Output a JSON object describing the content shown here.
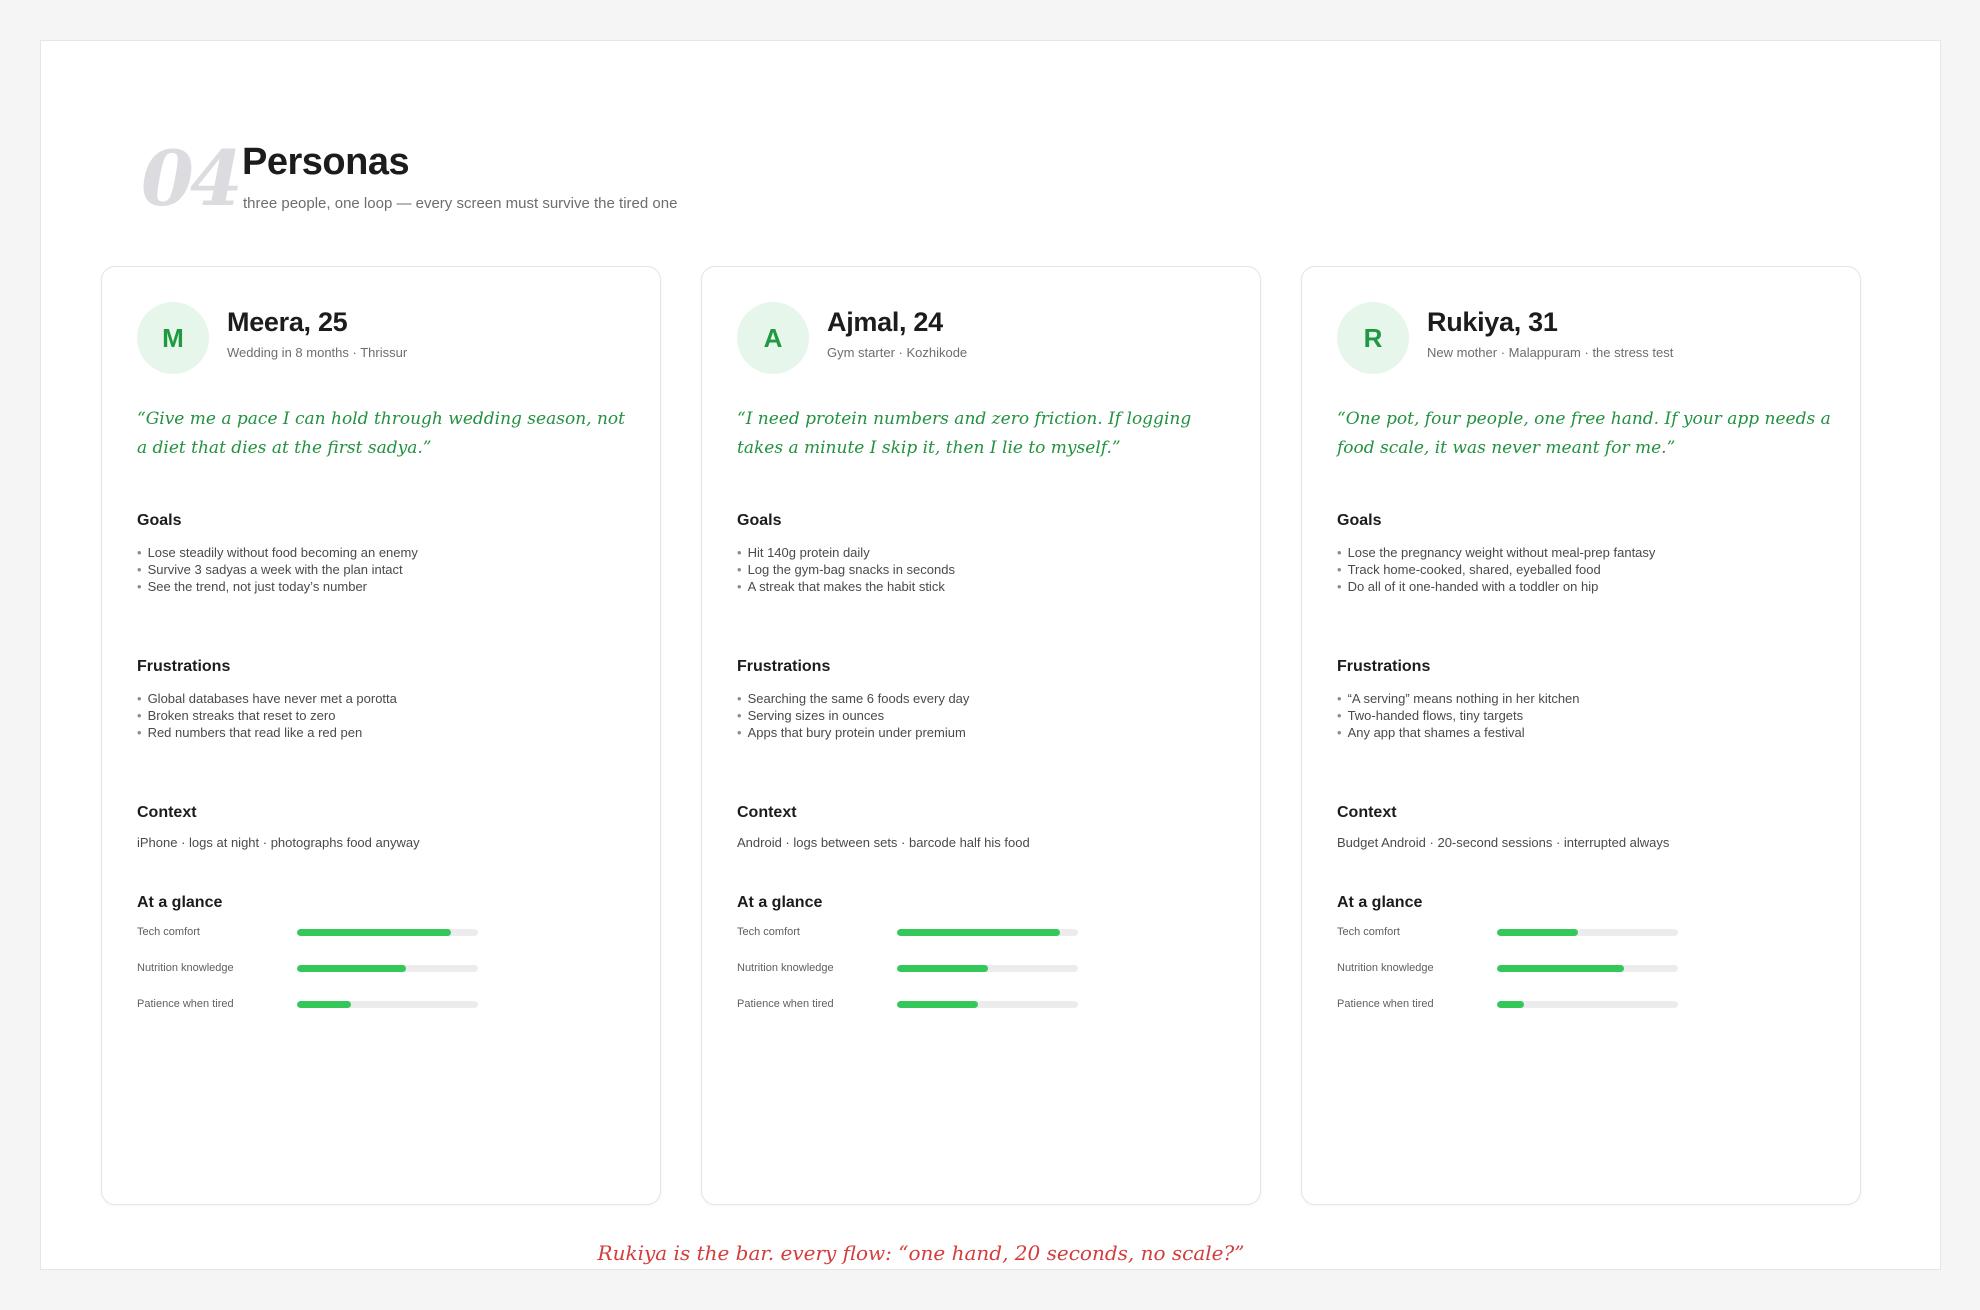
{
  "section": {
    "number": "04",
    "title": "Personas",
    "subtitle": "three people, one loop — every screen must survive the tired one"
  },
  "labels": {
    "goals": "Goals",
    "frustrations": "Frustrations",
    "context": "Context",
    "at_a_glance": "At a glance"
  },
  "personas": [
    {
      "initial": "M",
      "name": "Meera, 25",
      "meta": "Wedding in 8 months · Thrissur",
      "quote": "“Give me a pace I can hold through wedding season, not a diet that dies at the first sadya.”",
      "goals": [
        "Lose steadily without food becoming an enemy",
        "Survive 3 sadyas a week with the plan intact",
        "See the trend, not just today’s number"
      ],
      "frustrations": [
        "Global databases have never met a porotta",
        "Broken streaks that reset to zero",
        "Red numbers that read like a red pen"
      ],
      "context": "iPhone · logs at night · photographs food anyway",
      "metrics": [
        {
          "label": "Tech comfort",
          "value": 0.85
        },
        {
          "label": "Nutrition knowledge",
          "value": 0.6
        },
        {
          "label": "Patience when tired",
          "value": 0.3
        }
      ]
    },
    {
      "initial": "A",
      "name": "Ajmal, 24",
      "meta": "Gym starter · Kozhikode",
      "quote": "“I need protein numbers and zero friction. If logging takes a minute I skip it, then I lie to myself.”",
      "goals": [
        "Hit 140g protein daily",
        "Log the gym-bag snacks in seconds",
        "A streak that makes the habit stick"
      ],
      "frustrations": [
        "Searching the same 6 foods every day",
        "Serving sizes in ounces",
        "Apps that bury protein under premium"
      ],
      "context": "Android · logs between sets · barcode half his food",
      "metrics": [
        {
          "label": "Tech comfort",
          "value": 0.9
        },
        {
          "label": "Nutrition knowledge",
          "value": 0.5
        },
        {
          "label": "Patience when tired",
          "value": 0.45
        }
      ]
    },
    {
      "initial": "R",
      "name": "Rukiya, 31",
      "meta": "New mother · Malappuram · the stress test",
      "quote": "“One pot, four people, one free hand. If your app needs a food scale, it was never meant for me.”",
      "goals": [
        "Lose the pregnancy weight without meal-prep fantasy",
        "Track home-cooked, shared, eyeballed food",
        "Do all of it one-handed with a toddler on hip"
      ],
      "frustrations": [
        "“A serving” means nothing in her kitchen",
        "Two-handed flows, tiny targets",
        "Any app that shames a festival"
      ],
      "context": "Budget Android · 20-second sessions · interrupted always",
      "metrics": [
        {
          "label": "Tech comfort",
          "value": 0.45
        },
        {
          "label": "Nutrition knowledge",
          "value": 0.7
        },
        {
          "label": "Patience when tired",
          "value": 0.15
        }
      ]
    }
  ],
  "footnote": "Rukiya is the bar. every flow: “one hand, 20 seconds, no scale?”"
}
